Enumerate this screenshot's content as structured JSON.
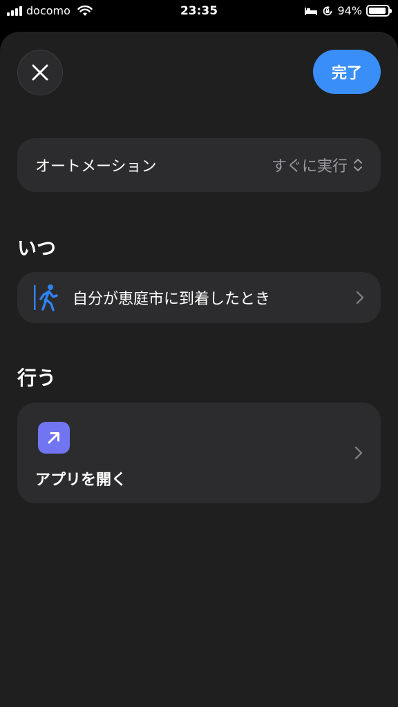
{
  "status_bar": {
    "carrier": "docomo",
    "time": "23:35",
    "battery": "94%",
    "battery_level": 0.94
  },
  "header": {
    "close_icon": "close-icon",
    "done_label": "完了"
  },
  "automation": {
    "label": "オートメーション",
    "value": "すぐに実行",
    "icon": "chevron-updown-icon"
  },
  "when": {
    "title": "いつ",
    "trigger_label": "自分が恵庭市に到着したとき",
    "icon": "walking-person-icon"
  },
  "do": {
    "title": "行う",
    "action_label": "アプリを開く",
    "icon": "open-app-arrow-icon"
  },
  "colors": {
    "accent": "#3a8ef7",
    "app_icon_bg": "#7275f1",
    "sheet_bg": "#1f1f1f",
    "card_bg": "#2c2c2e",
    "walk_icon": "#2f83f5"
  }
}
